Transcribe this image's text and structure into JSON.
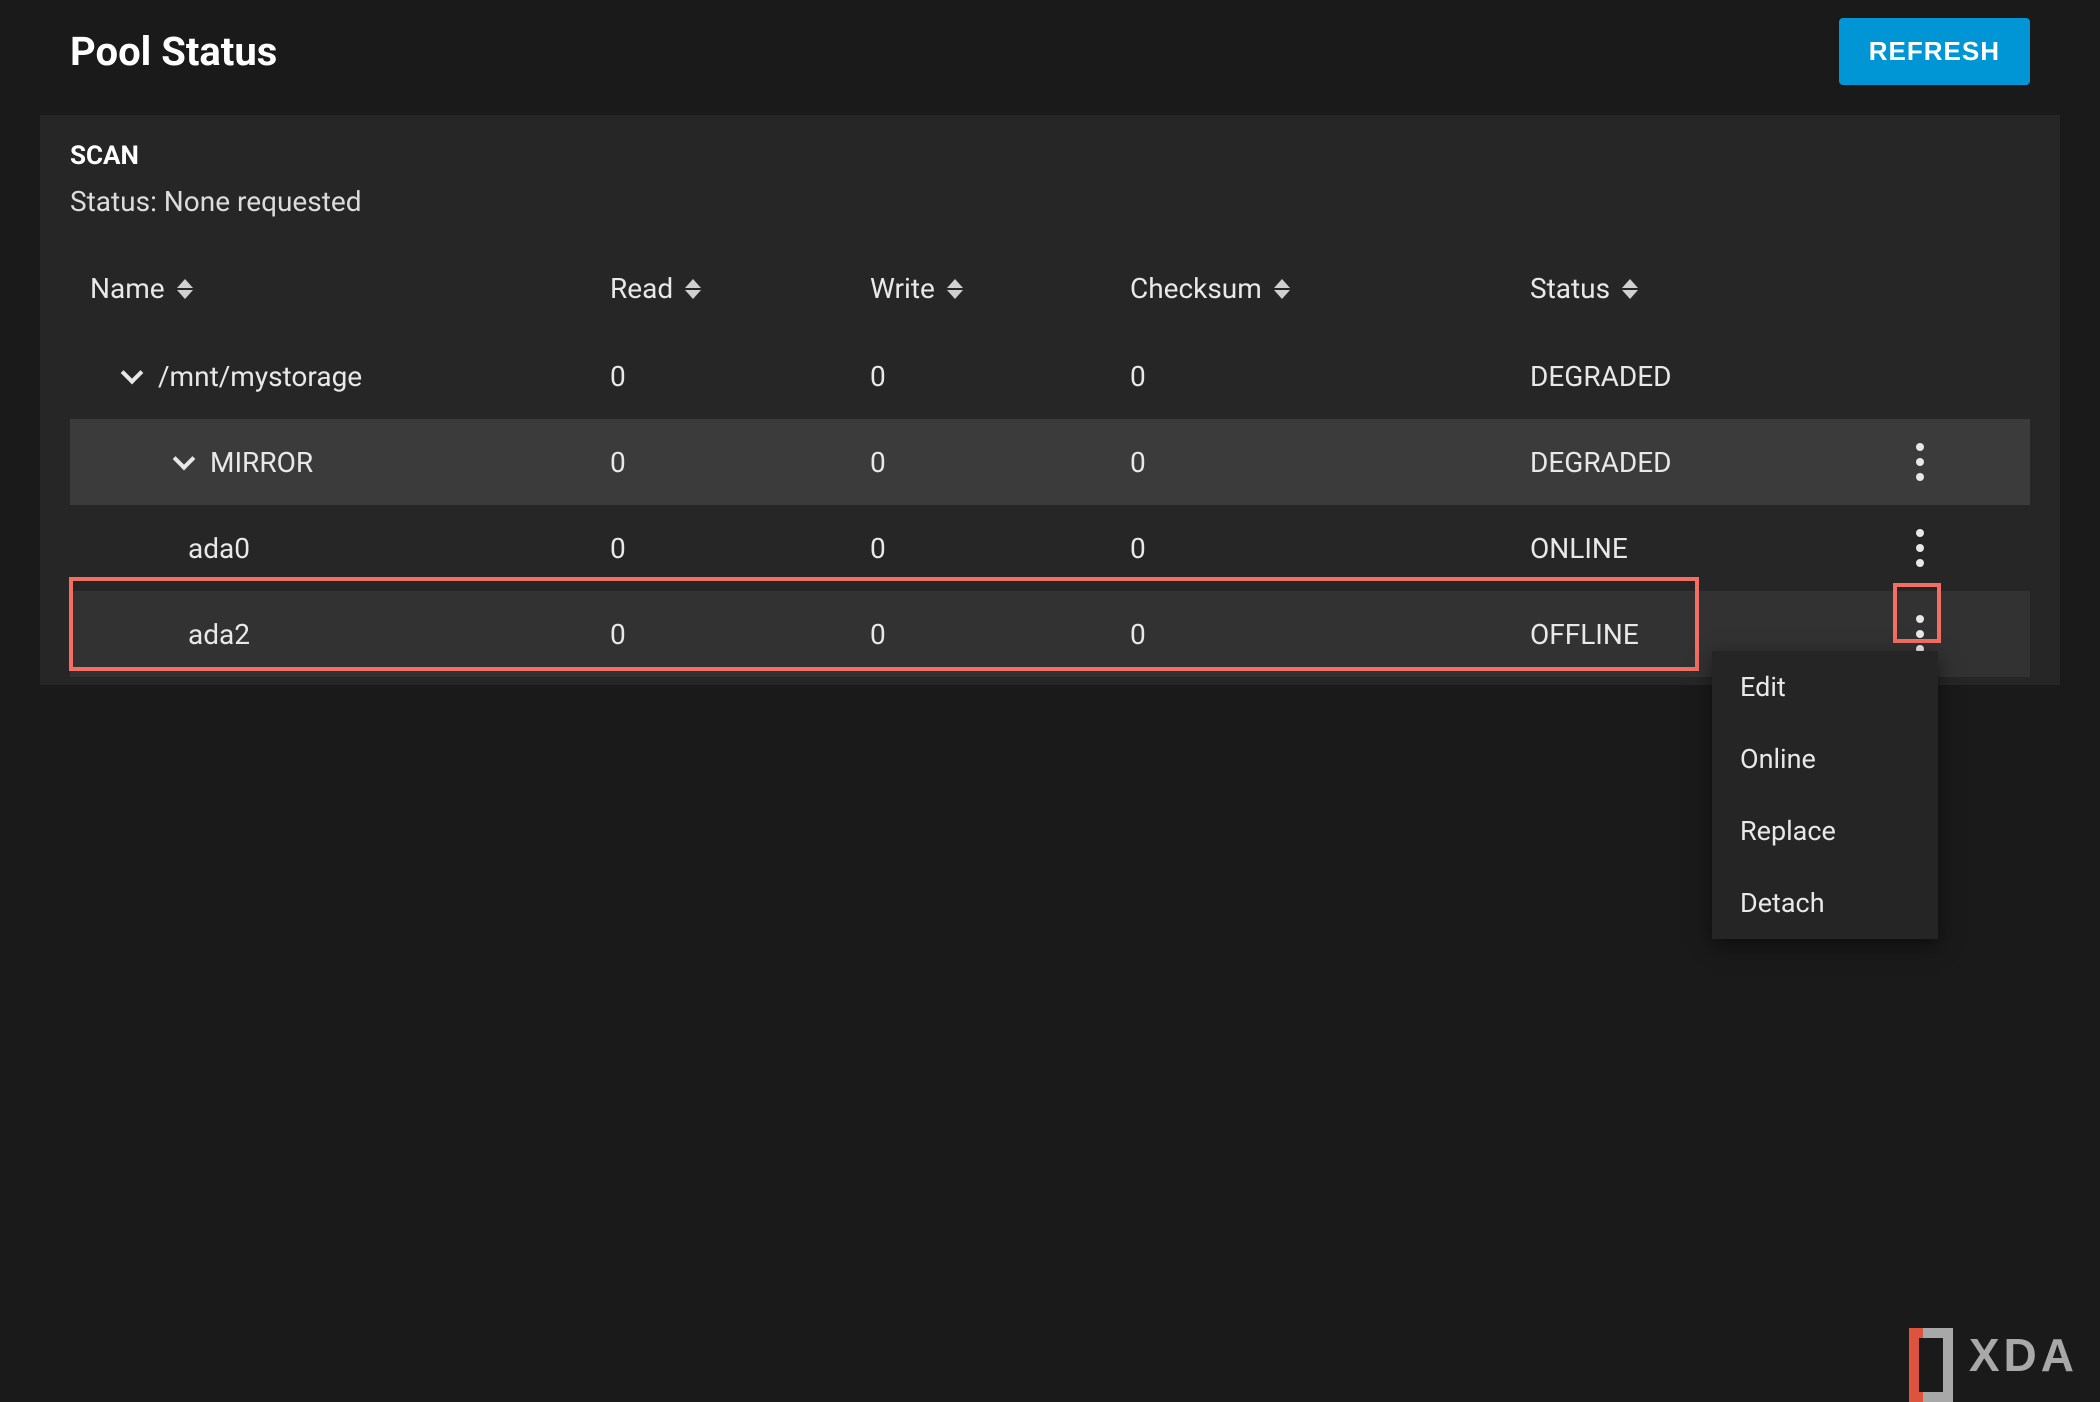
{
  "title": "Pool Status",
  "refresh_label": "REFRESH",
  "scan": {
    "heading": "SCAN",
    "status": "Status: None requested"
  },
  "columns": {
    "name": "Name",
    "read": "Read",
    "write": "Write",
    "checksum": "Checksum",
    "status": "Status"
  },
  "rows": [
    {
      "name": "/mnt/mystorage",
      "read": "0",
      "write": "0",
      "checksum": "0",
      "status": "DEGRADED",
      "indent": 1,
      "expandable": true,
      "has_actions": false,
      "alt": false
    },
    {
      "name": "MIRROR",
      "read": "0",
      "write": "0",
      "checksum": "0",
      "status": "DEGRADED",
      "indent": 2,
      "expandable": true,
      "has_actions": true,
      "alt": true
    },
    {
      "name": "ada0",
      "read": "0",
      "write": "0",
      "checksum": "0",
      "status": "ONLINE",
      "indent": 3,
      "expandable": false,
      "has_actions": true,
      "alt": false
    },
    {
      "name": "ada2",
      "read": "0",
      "write": "0",
      "checksum": "0",
      "status": "OFFLINE",
      "indent": 3,
      "expandable": false,
      "has_actions": true,
      "alt": true
    }
  ],
  "menu": {
    "edit": "Edit",
    "online": "Online",
    "replace": "Replace",
    "detach": "Detach"
  },
  "watermark": "XDA"
}
